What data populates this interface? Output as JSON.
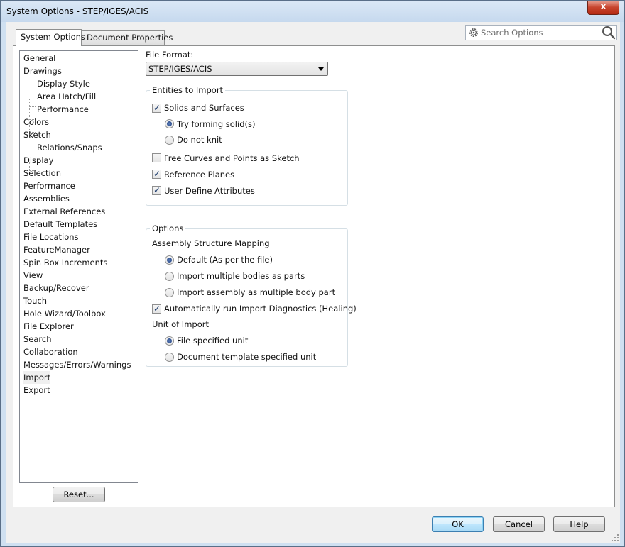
{
  "window": {
    "title": "System Options - STEP/IGES/ACIS",
    "close_glyph": "x"
  },
  "tabs": [
    {
      "label": "System Options",
      "active": true
    },
    {
      "label": "Document Properties",
      "active": false
    }
  ],
  "search": {
    "placeholder": "Search Options",
    "value": ""
  },
  "tree": {
    "items": [
      {
        "label": "General",
        "level": 0
      },
      {
        "label": "Drawings",
        "level": 0
      },
      {
        "label": "Display Style",
        "level": 1
      },
      {
        "label": "Area Hatch/Fill",
        "level": 1
      },
      {
        "label": "Performance",
        "level": 1
      },
      {
        "label": "Colors",
        "level": 0
      },
      {
        "label": "Sketch",
        "level": 0
      },
      {
        "label": "Relations/Snaps",
        "level": 1
      },
      {
        "label": "Display",
        "level": 0
      },
      {
        "label": "Selection",
        "level": 0
      },
      {
        "label": "Performance",
        "level": 0
      },
      {
        "label": "Assemblies",
        "level": 0
      },
      {
        "label": "External References",
        "level": 0
      },
      {
        "label": "Default Templates",
        "level": 0
      },
      {
        "label": "File Locations",
        "level": 0
      },
      {
        "label": "FeatureManager",
        "level": 0
      },
      {
        "label": "Spin Box Increments",
        "level": 0
      },
      {
        "label": "View",
        "level": 0
      },
      {
        "label": "Backup/Recover",
        "level": 0
      },
      {
        "label": "Touch",
        "level": 0
      },
      {
        "label": "Hole Wizard/Toolbox",
        "level": 0
      },
      {
        "label": "File Explorer",
        "level": 0
      },
      {
        "label": "Search",
        "level": 0
      },
      {
        "label": "Collaboration",
        "level": 0
      },
      {
        "label": "Messages/Errors/Warnings",
        "level": 0
      },
      {
        "label": "Import",
        "level": 0,
        "selected": true
      },
      {
        "label": "Export",
        "level": 0
      }
    ]
  },
  "reset_label": "Reset...",
  "file_format": {
    "label": "File Format:",
    "value": "STEP/IGES/ACIS"
  },
  "entities": {
    "title": "Entities to Import",
    "solids": {
      "label": "Solids and Surfaces",
      "checked": true
    },
    "try_forming": {
      "label": "Try forming solid(s)",
      "selected": true
    },
    "do_not_knit": {
      "label": "Do not knit",
      "selected": false
    },
    "free_curves": {
      "label": "Free Curves and Points as Sketch",
      "checked": false
    },
    "ref_planes": {
      "label": "Reference Planes",
      "checked": true
    },
    "user_attrs": {
      "label": "User Define Attributes",
      "checked": true
    }
  },
  "options": {
    "title": "Options",
    "asm_mapping_label": "Assembly Structure Mapping",
    "default_opt": {
      "label": "Default (As per the file)",
      "selected": true
    },
    "multi_bodies": {
      "label": "Import multiple bodies as parts",
      "selected": false
    },
    "asm_multi_body": {
      "label": "Import assembly as multiple body part",
      "selected": false
    },
    "auto_diag": {
      "label": "Automatically run Import Diagnostics (Healing)",
      "checked": true
    },
    "unit_label": "Unit of Import",
    "file_unit": {
      "label": "File specified unit",
      "selected": true
    },
    "doc_unit": {
      "label": "Document template specified unit",
      "selected": false
    }
  },
  "buttons": {
    "ok": "OK",
    "cancel": "Cancel",
    "help": "Help"
  }
}
